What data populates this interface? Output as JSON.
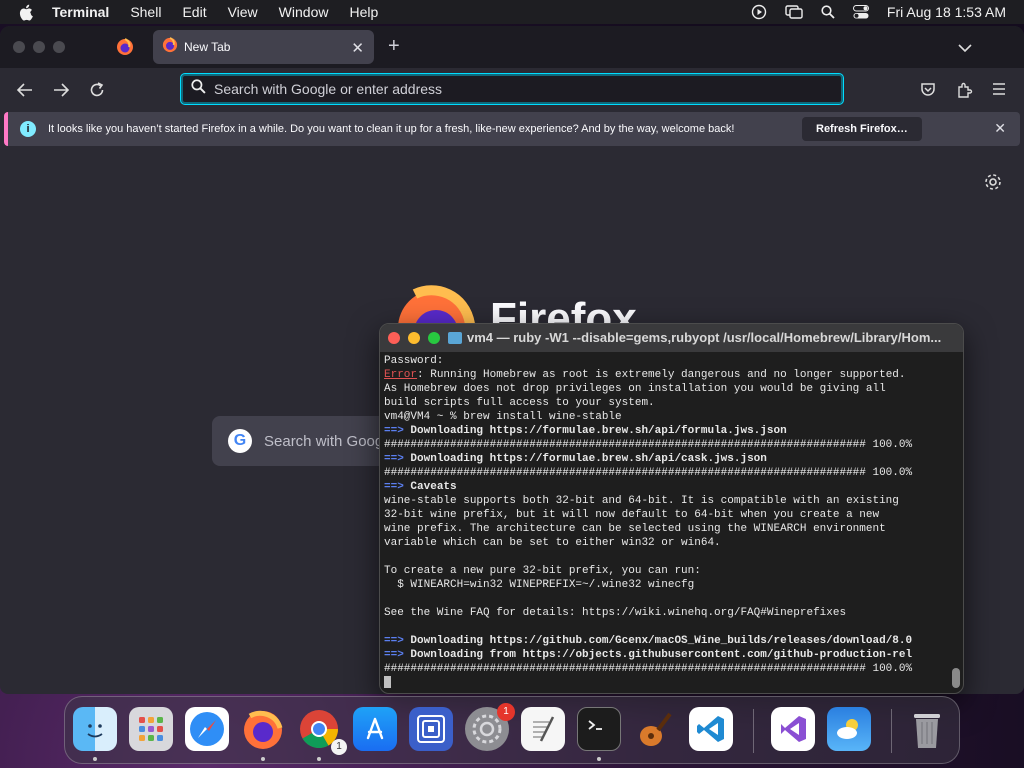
{
  "menubar": {
    "app_name": "Terminal",
    "items": [
      "Shell",
      "Edit",
      "View",
      "Window",
      "Help"
    ],
    "clock": "Fri Aug 18  1:53 AM"
  },
  "firefox": {
    "tab_title": "New Tab",
    "url_placeholder": "Search with Google or enter address",
    "notification": {
      "message": "It looks like you haven’t started Firefox in a while. Do you want to clean it up for a fresh, like-new experience? And by the way, welcome back!",
      "button": "Refresh Firefox…"
    },
    "wordmark": "Firefox",
    "search_placeholder": "Search with Goog"
  },
  "terminal": {
    "title": "vm4 — ruby -W1 --disable=gems,rubyopt /usr/local/Homebrew/Library/Hom...",
    "lines": [
      {
        "t": "Password:"
      },
      {
        "err": "Error",
        "t": ": Running Homebrew as root is extremely dangerous and no longer supported."
      },
      {
        "t": "As Homebrew does not drop privileges on installation you would be giving all"
      },
      {
        "t": "build scripts full access to your system."
      },
      {
        "t": "vm4@VM4 ~ % brew install wine-stable"
      },
      {
        "arrow": "==>",
        "b": " Downloading https://formulae.brew.sh/api/formula.jws.json"
      },
      {
        "t": "######################################################################### 100.0%"
      },
      {
        "arrow": "==>",
        "b": " Downloading https://formulae.brew.sh/api/cask.jws.json"
      },
      {
        "t": "######################################################################### 100.0%"
      },
      {
        "arrow": "==>",
        "b": " Caveats"
      },
      {
        "t": "wine-stable supports both 32-bit and 64-bit. It is compatible with an existing"
      },
      {
        "t": "32-bit wine prefix, but it will now default to 64-bit when you create a new"
      },
      {
        "t": "wine prefix. The architecture can be selected using the WINEARCH environment"
      },
      {
        "t": "variable which can be set to either win32 or win64."
      },
      {
        "t": ""
      },
      {
        "t": "To create a new pure 32-bit prefix, you can run:"
      },
      {
        "t": "  $ WINEARCH=win32 WINEPREFIX=~/.wine32 winecfg"
      },
      {
        "t": ""
      },
      {
        "t": "See the Wine FAQ for details: https://wiki.winehq.org/FAQ#Wineprefixes"
      },
      {
        "t": ""
      },
      {
        "arrow": "==>",
        "b": " Downloading https://github.com/Gcenx/macOS_Wine_builds/releases/download/8.0"
      },
      {
        "arrow": "==>",
        "b": " Downloading from https://objects.githubusercontent.com/github-production-rel"
      },
      {
        "t": "######################################################################### 100.0%"
      }
    ]
  },
  "dock": {
    "system_settings_badge": "1",
    "chrome_badge": "1"
  }
}
